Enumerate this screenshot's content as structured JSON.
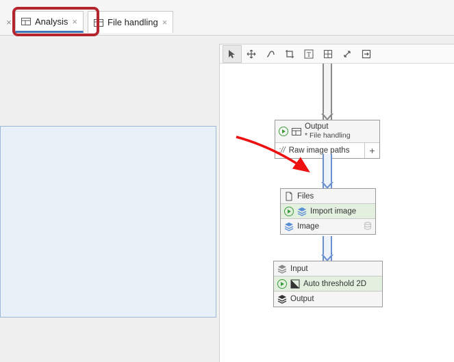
{
  "tabs": {
    "analysis": "Analysis",
    "file_handling": "File handling"
  },
  "node1": {
    "title": "Output",
    "subtitle": "* File handling",
    "slot_prefix": "://",
    "slot_label": "Raw image paths"
  },
  "node2": {
    "head": "Files",
    "action": "Import image",
    "foot": "Image"
  },
  "node3": {
    "head": "Input",
    "action": "Auto threshold 2D",
    "foot": "Output"
  }
}
